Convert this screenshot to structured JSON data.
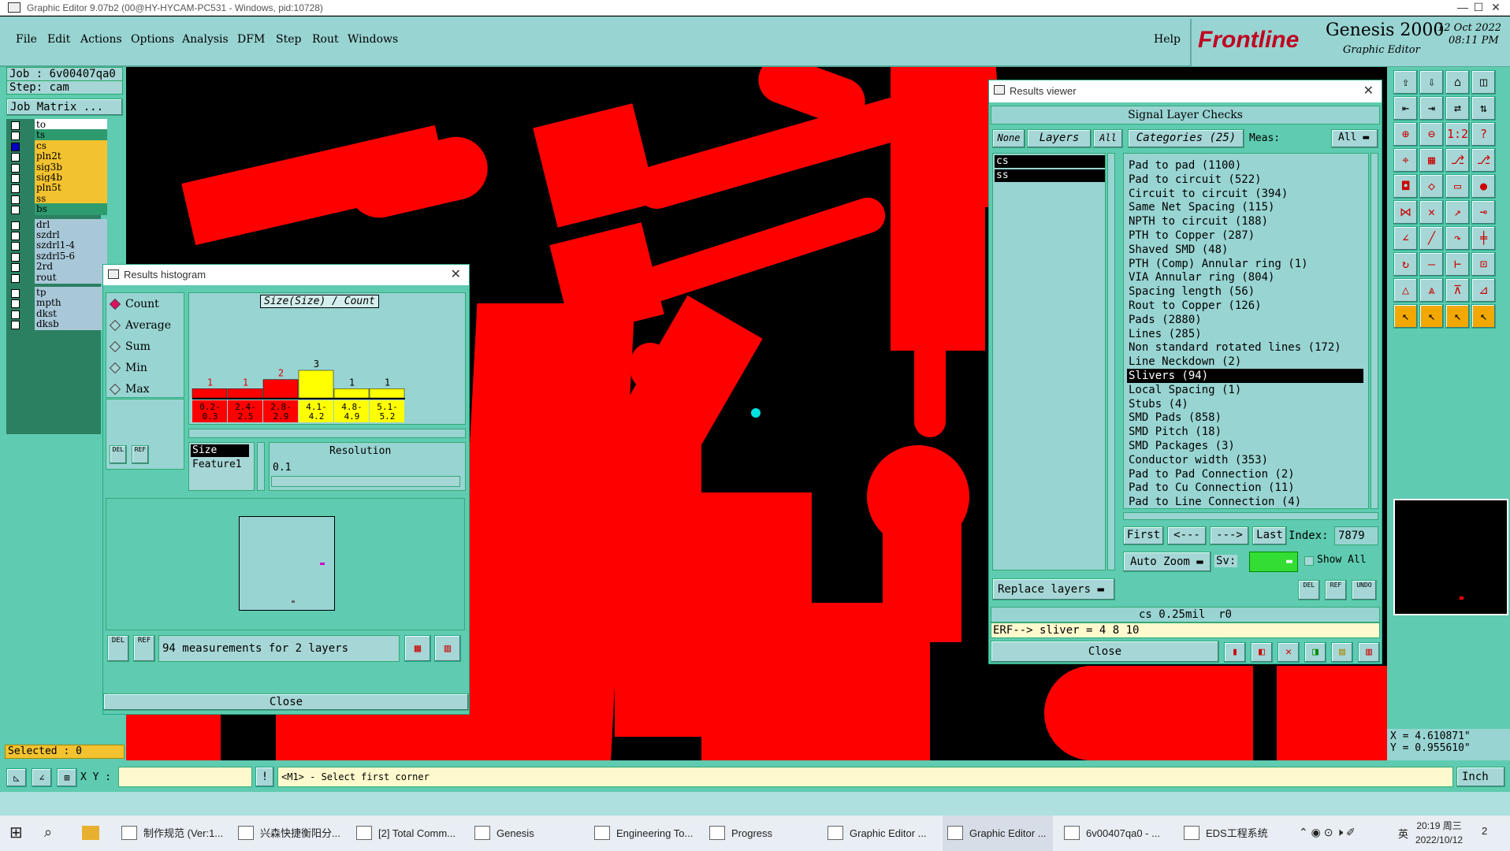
{
  "window": {
    "title": "Graphic Editor 9.07b2 (00@HY-HYCAM-PC531 - Windows, pid:10728)",
    "minimize": "—",
    "maximize": "☐",
    "close": "✕"
  },
  "menu": [
    "File",
    "Edit",
    "Actions",
    "Options",
    "Analysis",
    "DFM",
    "Step",
    "Rout",
    "Windows"
  ],
  "help": "Help",
  "logo": {
    "brand": "Frontline",
    "product": "Genesis 2000",
    "sub": "Graphic Editor",
    "date": "12 Oct 2022",
    "time": "08:11 PM"
  },
  "job": {
    "job": "Job : 6v00407qa0",
    "step": "Step: cam",
    "matrix": "Job Matrix ..."
  },
  "layers": [
    {
      "name": "to",
      "color": "#ffffff"
    },
    {
      "name": "ts",
      "color": "#2e9b6f"
    },
    {
      "name": "cs",
      "color": "#f2c230",
      "marker": "⬥▪"
    },
    {
      "name": "pln2t",
      "color": "#f2c230"
    },
    {
      "name": "sig3b",
      "color": "#f2c230"
    },
    {
      "name": "sig4b",
      "color": "#f2c230",
      "marker": "⬥"
    },
    {
      "name": "pln5t",
      "color": "#f2c230"
    },
    {
      "name": "ss",
      "color": "#f2c230",
      "marker": "⬥"
    },
    {
      "name": "bs",
      "color": "#2e9b6f"
    },
    {
      "name": "drl",
      "color": "#a8c8d8"
    },
    {
      "name": "szdrl",
      "color": "#a8c8d8"
    },
    {
      "name": "szdrl1-4",
      "color": "#a8c8d8"
    },
    {
      "name": "szdrl5-6",
      "color": "#a8c8d8"
    },
    {
      "name": "2rd",
      "color": "#a8c8d8"
    },
    {
      "name": "rout",
      "color": "#a8c8d8"
    },
    {
      "name": "tp",
      "color": "#a8c8d8"
    },
    {
      "name": "mpth",
      "color": "#a8c8d8"
    },
    {
      "name": "dkst",
      "color": "#a8c8d8"
    },
    {
      "name": "dksb",
      "color": "#a8c8d8"
    }
  ],
  "selected": "Selected : 0",
  "histogram": {
    "title": "Results histogram",
    "modes": [
      "Count",
      "Average",
      "Sum",
      "Min",
      "Max"
    ],
    "selected_mode": "Count",
    "chart_title": "Size(Size) / Count",
    "bars": [
      {
        "label": "0.2-\n0.3",
        "count": 1,
        "color": "#ff0000"
      },
      {
        "label": "2.4-\n2.5",
        "count": 1,
        "color": "#ff0000"
      },
      {
        "label": "2.8-\n2.9",
        "count": 2,
        "color": "#ff0000"
      },
      {
        "label": "4.1-\n4.2",
        "count": 3,
        "color": "#ffff00"
      },
      {
        "label": "4.8-\n4.9",
        "count": 1,
        "color": "#ffff00"
      },
      {
        "label": "5.1-\n5.2",
        "count": 1,
        "color": "#ffff00"
      }
    ],
    "fields": [
      "Size",
      "Feature1"
    ],
    "resolution_label": "Resolution",
    "resolution_value": "0.1",
    "del": "DEL",
    "ref": "REF",
    "summary": "94 measurements for 2 layers",
    "close": "Close"
  },
  "results": {
    "title": "Results viewer",
    "header": "Signal Layer Checks",
    "none": "None",
    "layers": "Layers",
    "all": "All",
    "categories": "Categories (25)",
    "meas": "Meas:",
    "meas_value": "All",
    "layer_list": [
      "cs",
      "ss"
    ],
    "items": [
      "Pad to pad (1100)",
      "Pad to circuit (522)",
      "Circuit to circuit (394)",
      "Same Net Spacing (115)",
      "NPTH to circuit (188)",
      "PTH to Copper (287)",
      "Shaved SMD (48)",
      "PTH (Comp) Annular ring (1)",
      "VIA Annular ring (804)",
      "Spacing length (56)",
      "Rout to Copper (126)",
      "Pads (2880)",
      "Lines (285)",
      "Non standard rotated lines (172)",
      "Line Neckdown (2)",
      "Slivers (94)",
      "Local Spacing (1)",
      "Stubs (4)",
      "SMD Pads (858)",
      "SMD Pitch (18)",
      "SMD Packages (3)",
      "Conductor width (353)",
      "Pad to Pad Connection (2)",
      "Pad to Cu Connection (11)",
      "Pad to Line Connection (4)"
    ],
    "selected_item": "Slivers (94)",
    "first": "First",
    "prev": "<---",
    "next": "--->",
    "last": "Last",
    "index_label": "Index:",
    "index": "7879",
    "auto_zoom": "Auto Zoom",
    "sv": "Sv:",
    "show_all": "Show All",
    "replace_layers": "Replace layers",
    "info": "cs 0.25mil  r0",
    "erf": "ERF--> sliver = 4 8 10",
    "close": "Close",
    "del": "DEL",
    "ref": "REF",
    "undo": "UNDO"
  },
  "coords": {
    "x": "X = 4.610871\"",
    "y": "Y = 0.955610\""
  },
  "status": {
    "xy": "X Y :",
    "prompt": "<M1> - Select first corner",
    "units": "Inch"
  },
  "taskbar": [
    "制作规范 (Ver:1...",
    "兴森快捷衡阳分...",
    "[2] Total Comm...",
    "Genesis",
    "Engineering To...",
    "Progress",
    "Graphic Editor ...",
    "Graphic Editor ...",
    "6v00407qa0 - ...",
    "EDS工程系统"
  ],
  "tray": {
    "time": "20:19 周三",
    "date": "2022/10/12",
    "lang": "英",
    "notif": "2"
  }
}
